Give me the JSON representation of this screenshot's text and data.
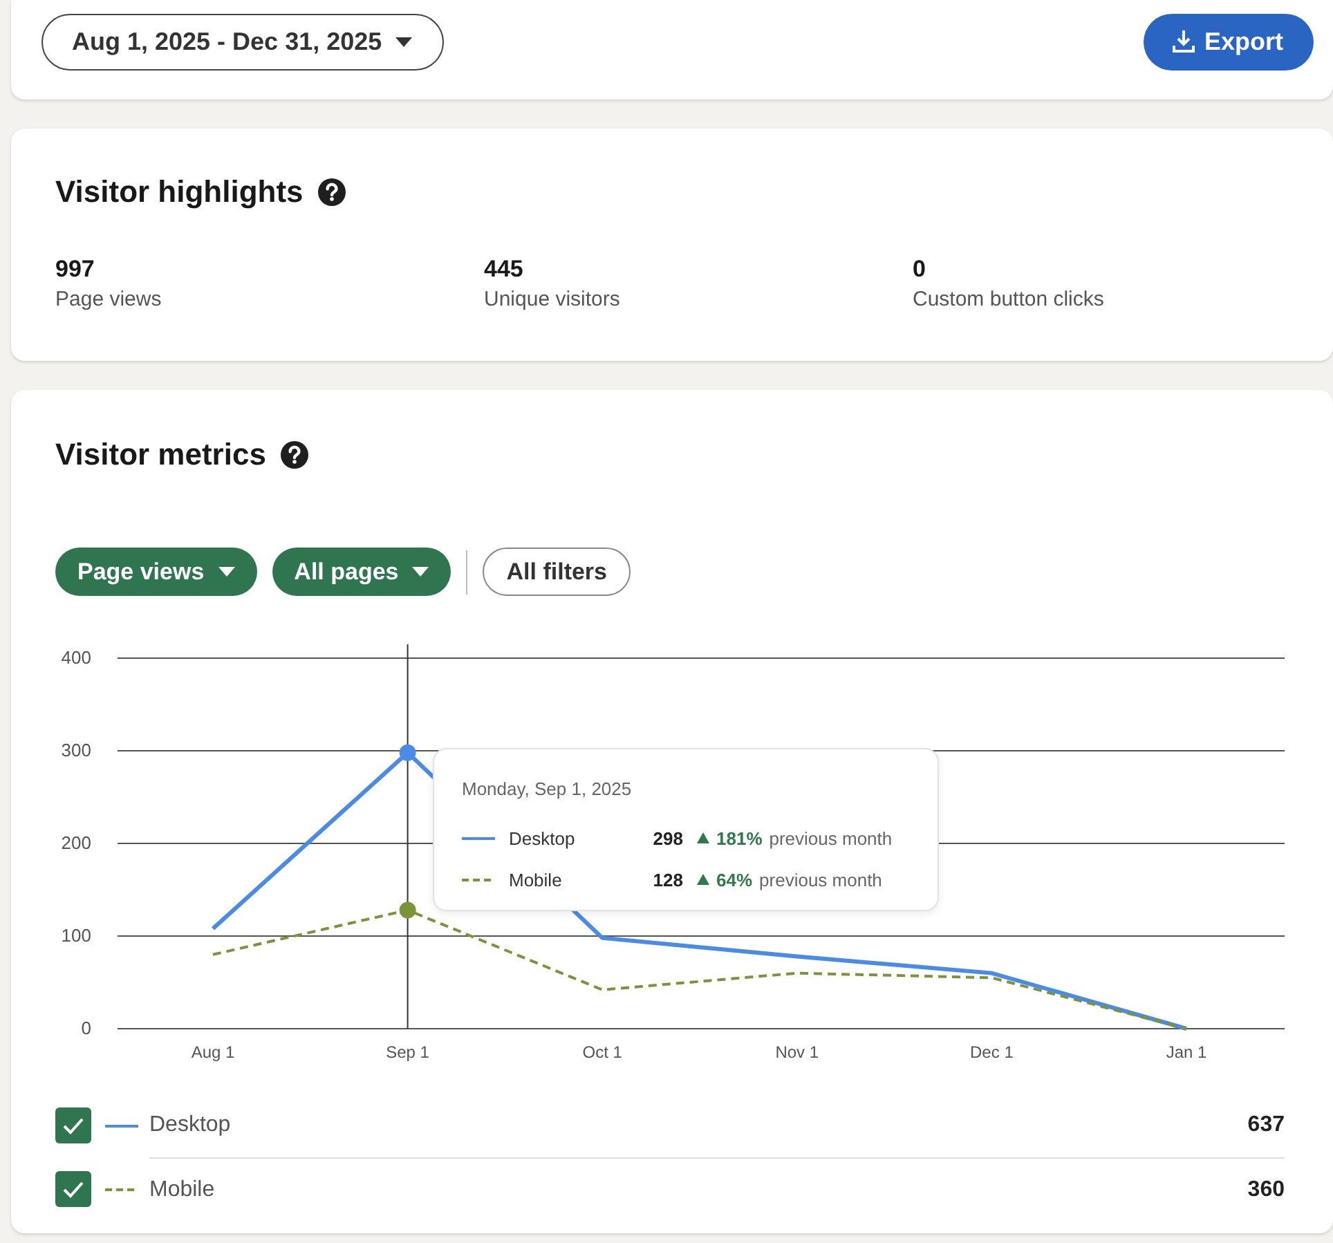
{
  "toolbar": {
    "date_range": "Aug 1, 2025 - Dec 31, 2025",
    "export_button": "Export"
  },
  "visitor_highlights": {
    "title": "Visitor highlights",
    "stats": [
      {
        "value": "997",
        "label": "Page views"
      },
      {
        "value": "445",
        "label": "Unique visitors"
      },
      {
        "value": "0",
        "label": "Custom button clicks"
      }
    ]
  },
  "visitor_metrics": {
    "title": "Visitor metrics",
    "filters": [
      {
        "label": "Page views",
        "kind": "dropdown"
      },
      {
        "label": "All pages",
        "kind": "dropdown"
      },
      {
        "label": "All filters",
        "kind": "plain"
      }
    ],
    "chart_data": {
      "type": "line",
      "grid": true,
      "legend": true,
      "ref_lines": [
        {
          "axis": "x",
          "value": "Sep 1"
        }
      ],
      "categories": [
        "Aug 1",
        "Sep 1",
        "Oct 1",
        "Nov 1",
        "Dec 1",
        "Jan 1"
      ],
      "ylim": [
        0,
        400
      ],
      "yticks": [
        0,
        100,
        200,
        300,
        400
      ],
      "series": [
        {
          "name": "Desktop",
          "color": "#4a8be6",
          "line_style": "solid",
          "values": [
            108,
            298,
            98,
            78,
            60,
            0
          ]
        },
        {
          "name": "Mobile",
          "color": "#7b9439",
          "line_style": "dashed",
          "values": [
            80,
            128,
            42,
            60,
            55,
            0
          ]
        }
      ]
    },
    "tooltip": {
      "title": "Monday, Sep 1, 2025",
      "rows": [
        {
          "name": "Desktop",
          "value": "298",
          "trend_up": true,
          "change": "181%",
          "note": "previous month"
        },
        {
          "name": "Mobile",
          "value": "128",
          "trend_up": true,
          "change": "64%",
          "note": "previous month"
        }
      ]
    },
    "legend": [
      {
        "checked": true,
        "total": "637"
      },
      {
        "checked": true,
        "total": "360"
      }
    ]
  }
}
